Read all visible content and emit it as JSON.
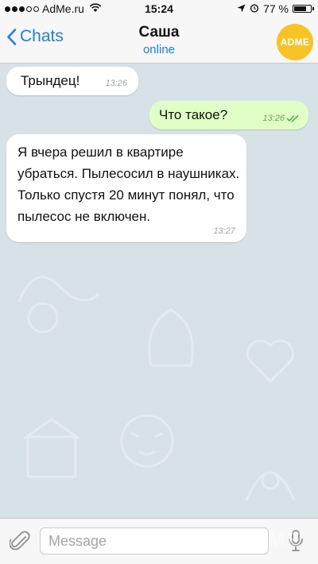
{
  "status_bar": {
    "carrier": "AdMe.ru",
    "time": "15:24",
    "battery_percent": "77 %",
    "battery_level": 0.77,
    "signal_bars_filled": 3,
    "icons": [
      "signal-icon",
      "wifi-icon",
      "location-icon",
      "alarm-icon",
      "battery-icon"
    ]
  },
  "nav": {
    "back_label": "Chats",
    "title": "Саша",
    "subtitle": "online",
    "avatar_text": "ADME",
    "avatar_color": "#f7c325",
    "accent_color": "#1a7ef5"
  },
  "messages": [
    {
      "direction": "incoming",
      "text": "Трындец!",
      "time": "13:26"
    },
    {
      "direction": "outgoing",
      "text": "Что такое?",
      "time": "13:26",
      "status": "read"
    },
    {
      "direction": "incoming",
      "text": "Я вчера решил в квартире убраться. Пылесосил в наушниках. Только спустя 20 минут понял, что пылесос не включен.",
      "time": "13:27"
    }
  ],
  "input": {
    "placeholder": "Message",
    "value": ""
  },
  "watermark": "ADME",
  "colors": {
    "chat_background": "#d7e2e6",
    "incoming_bubble": "#ffffff",
    "outgoing_bubble": "#e1fec6",
    "read_ticks": "#5cae58"
  }
}
